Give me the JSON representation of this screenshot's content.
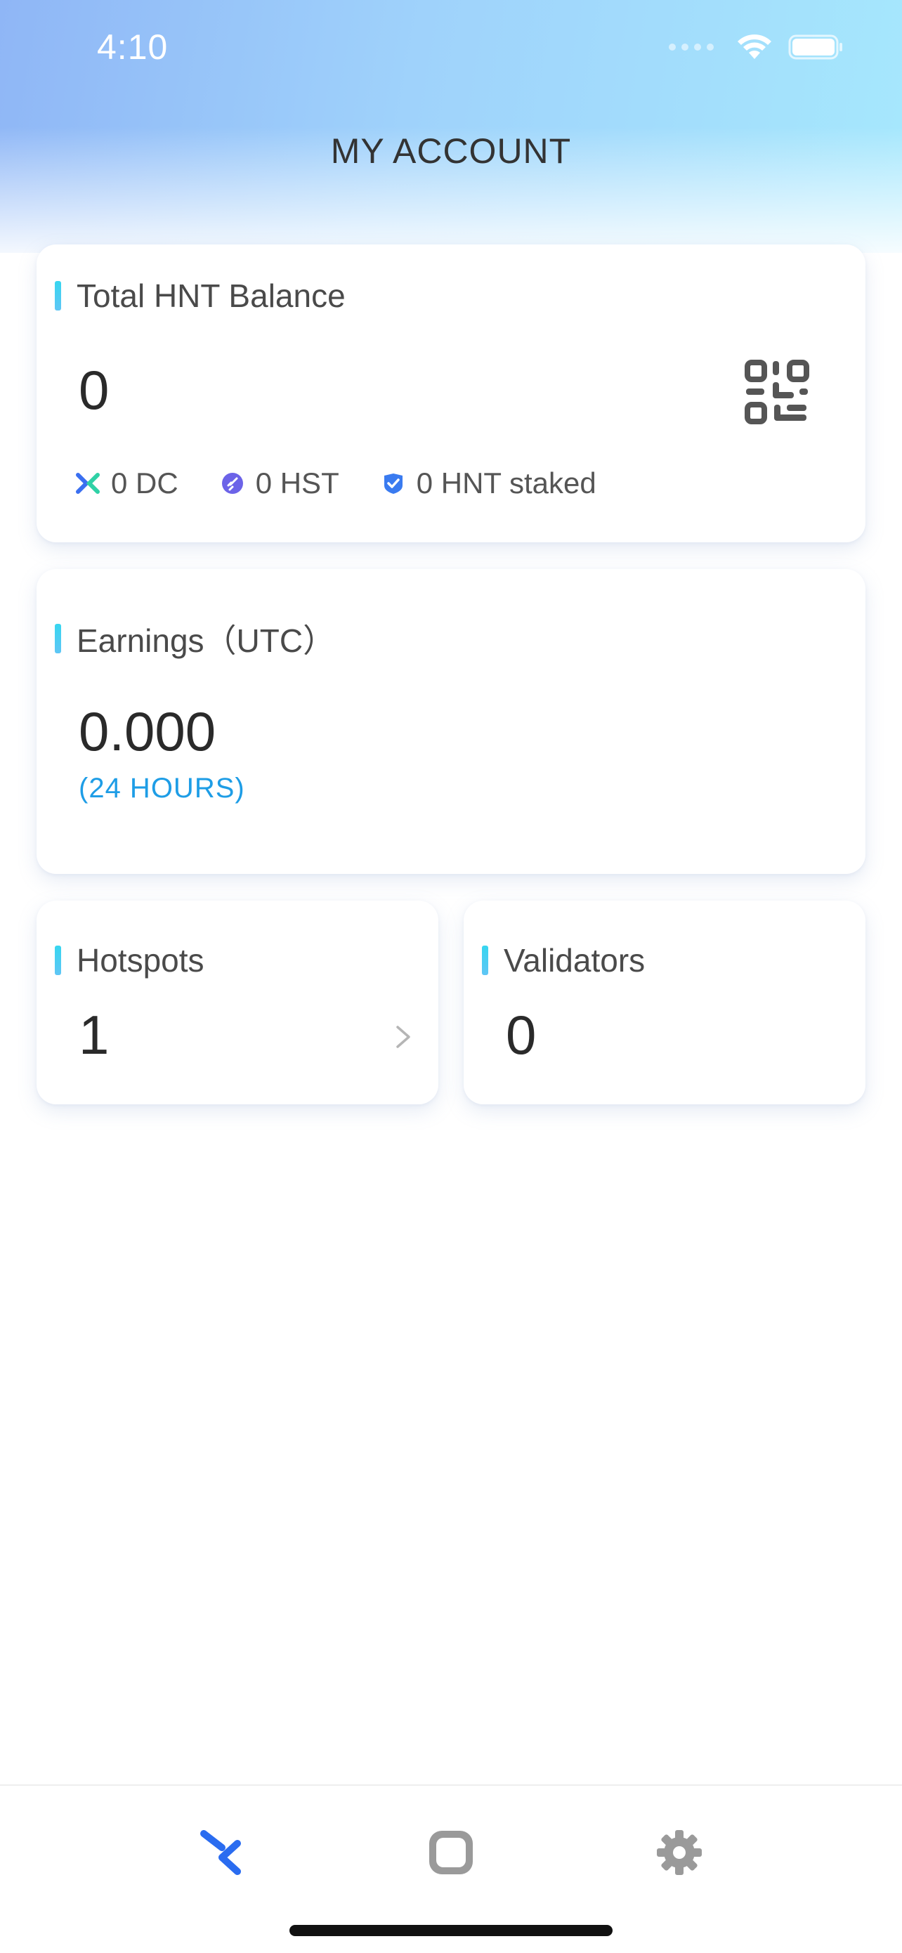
{
  "status_bar": {
    "time": "4:10",
    "icons": [
      "cellular-signal-icon",
      "wifi-icon",
      "battery-icon"
    ]
  },
  "header": {
    "title": "MY ACCOUNT"
  },
  "balance": {
    "title": "Total HNT Balance",
    "value": "0",
    "qr_icon": "qr-code-icon",
    "dc": "0 DC",
    "hst": "0 HST",
    "staked": "0 HNT staked"
  },
  "earnings": {
    "title": "Earnings（UTC）",
    "value": "0.000",
    "period": "(24 HOURS)"
  },
  "hotspots": {
    "title": "Hotspots",
    "value": "1"
  },
  "validators": {
    "title": "Validators",
    "value": "0"
  },
  "bottom_nav": {
    "items": [
      {
        "name": "account",
        "icon": "helium-logo-icon",
        "active": true
      },
      {
        "name": "devices",
        "icon": "rounded-square-icon",
        "active": false
      },
      {
        "name": "settings",
        "icon": "gear-icon",
        "active": false
      }
    ]
  },
  "colors": {
    "accent": "#1e9de6",
    "nav_active": "#2a6cf0",
    "nav_inactive": "#9a9a9a",
    "title_bar_accent": "#37d6f0"
  }
}
